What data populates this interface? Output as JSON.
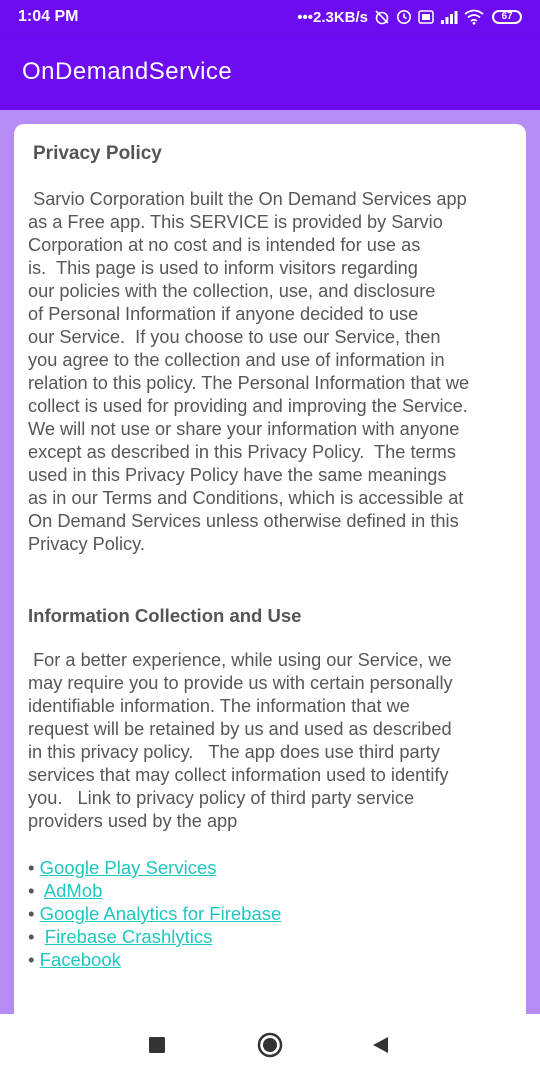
{
  "status_bar": {
    "time": "1:04 PM",
    "network_speed": "•••2.3KB/s",
    "battery": "67",
    "icons": [
      "alarm-off-icon",
      "clock-icon",
      "volte-icon",
      "signal-icon",
      "wifi-icon",
      "battery-icon"
    ]
  },
  "app_bar": {
    "title": "OnDemandService",
    "color": "#6d0cf0"
  },
  "content": {
    "title": "Privacy Policy",
    "intro": " Sarvio Corporation built the On Demand Services app\nas a Free app. This SERVICE is provided by Sarvio\nCorporation at no cost and is intended for use as\nis.  This page is used to inform visitors regarding\nour policies with the collection, use, and disclosure\nof Personal Information if anyone decided to use\nour Service.  If you choose to use our Service, then\nyou agree to the collection and use of information in\nrelation to this policy. The Personal Information that we\ncollect is used for providing and improving the Service.\nWe will not use or share your information with anyone\nexcept as described in this Privacy Policy.  The terms\nused in this Privacy Policy have the same meanings\nas in our Terms and Conditions, which is accessible at\nOn Demand Services unless otherwise defined in this\nPrivacy Policy.",
    "section_heading": "Information Collection and Use",
    "section_body": " For a better experience, while using our Service, we\nmay require you to provide us with certain personally\nidentifiable information. The information that we\nrequest will be retained by us and used as described\nin this privacy policy.   The app does use third party\nservices that may collect information used to identify\nyou.   Link to privacy policy of third party service\nproviders used by the app",
    "links": [
      {
        "bullet": "• ",
        "label": "Google Play Services"
      },
      {
        "bullet": "•  ",
        "label": "AdMob"
      },
      {
        "bullet": "• ",
        "label": "Google Analytics for Firebase"
      },
      {
        "bullet": "•  ",
        "label": "Firebase Crashlytics"
      },
      {
        "bullet": "• ",
        "label": "Facebook"
      }
    ],
    "link_color": "#1ec8c0"
  },
  "nav_bar": {
    "buttons": [
      "recents-icon",
      "home-icon",
      "back-icon"
    ]
  }
}
